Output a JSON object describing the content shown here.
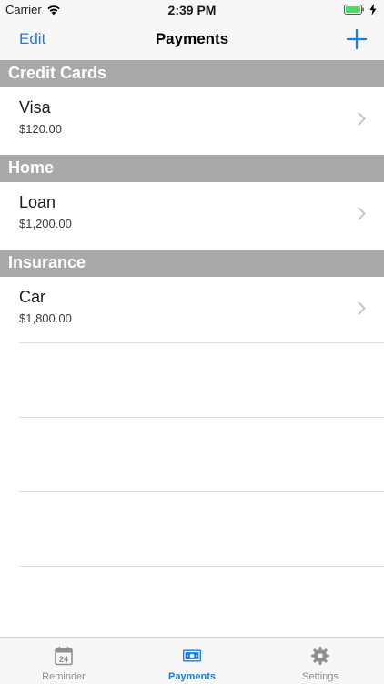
{
  "status_bar": {
    "carrier": "Carrier",
    "time": "2:39 PM"
  },
  "nav": {
    "edit_label": "Edit",
    "title": "Payments",
    "add_icon": "plus-icon"
  },
  "sections": [
    {
      "header": "Credit Cards",
      "rows": [
        {
          "title": "Visa",
          "amount": "$120.00"
        }
      ]
    },
    {
      "header": "Home",
      "rows": [
        {
          "title": "Loan",
          "amount": "$1,200.00"
        }
      ]
    },
    {
      "header": "Insurance",
      "rows": [
        {
          "title": "Car",
          "amount": "$1,800.00"
        }
      ]
    }
  ],
  "tab_bar": {
    "tabs": [
      {
        "label": "Reminder",
        "icon": "calendar-icon",
        "badge": "24",
        "active": false
      },
      {
        "label": "Payments",
        "icon": "payments-icon",
        "active": true
      },
      {
        "label": "Settings",
        "icon": "gear-icon",
        "active": false
      }
    ]
  },
  "colors": {
    "accent": "#1a7ee0",
    "section_header_bg": "#a9a9a9",
    "battery": "#4cd964"
  }
}
